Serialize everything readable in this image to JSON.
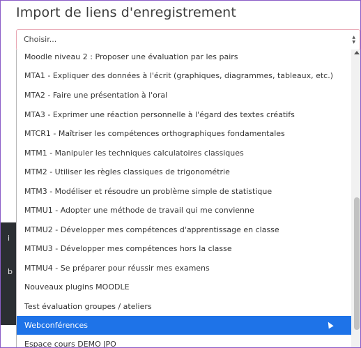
{
  "heading": "Import de liens d'enregistrement",
  "select": {
    "value": "Choisir...",
    "caret_up": "▲",
    "caret_down": "▼"
  },
  "background": {
    "letter1": "i",
    "letter2": "b"
  },
  "options": [
    "Moodle niveau 2 : Proposer une évaluation par les pairs",
    "MTA1 - Expliquer des données à l'écrit (graphiques, diagrammes, tableaux, etc.)",
    "MTA2 - Faire une présentation à l'oral",
    "MTA3 - Exprimer une réaction personnelle à l'égard des textes créatifs",
    "MTCR1 - Maîtriser les compétences orthographiques fondamentales",
    "MTM1 - Manipuler les techniques calculatoires classiques",
    "MTM2 - Utiliser les règles classiques de trigonométrie",
    "MTM3 - Modéliser et résoudre un problème simple de statistique",
    "MTMU1 - Adopter une méthode de travail qui me convienne",
    "MTMU2 - Développer mes compétences d'apprentissage en classe",
    "MTMU3 - Développer mes compétences hors la classe",
    "MTMU4 - Se préparer pour réussir mes examens",
    "Nouveaux plugins MOODLE",
    "Test évaluation groupes / ateliers",
    "Webconférences",
    "Espace cours DEMO JPO"
  ],
  "selected_option": "Webconférences",
  "colors": {
    "selected_bg": "#1e73e8",
    "select_border": "#e8a6b3",
    "frame_border": "#8a5cc7"
  }
}
